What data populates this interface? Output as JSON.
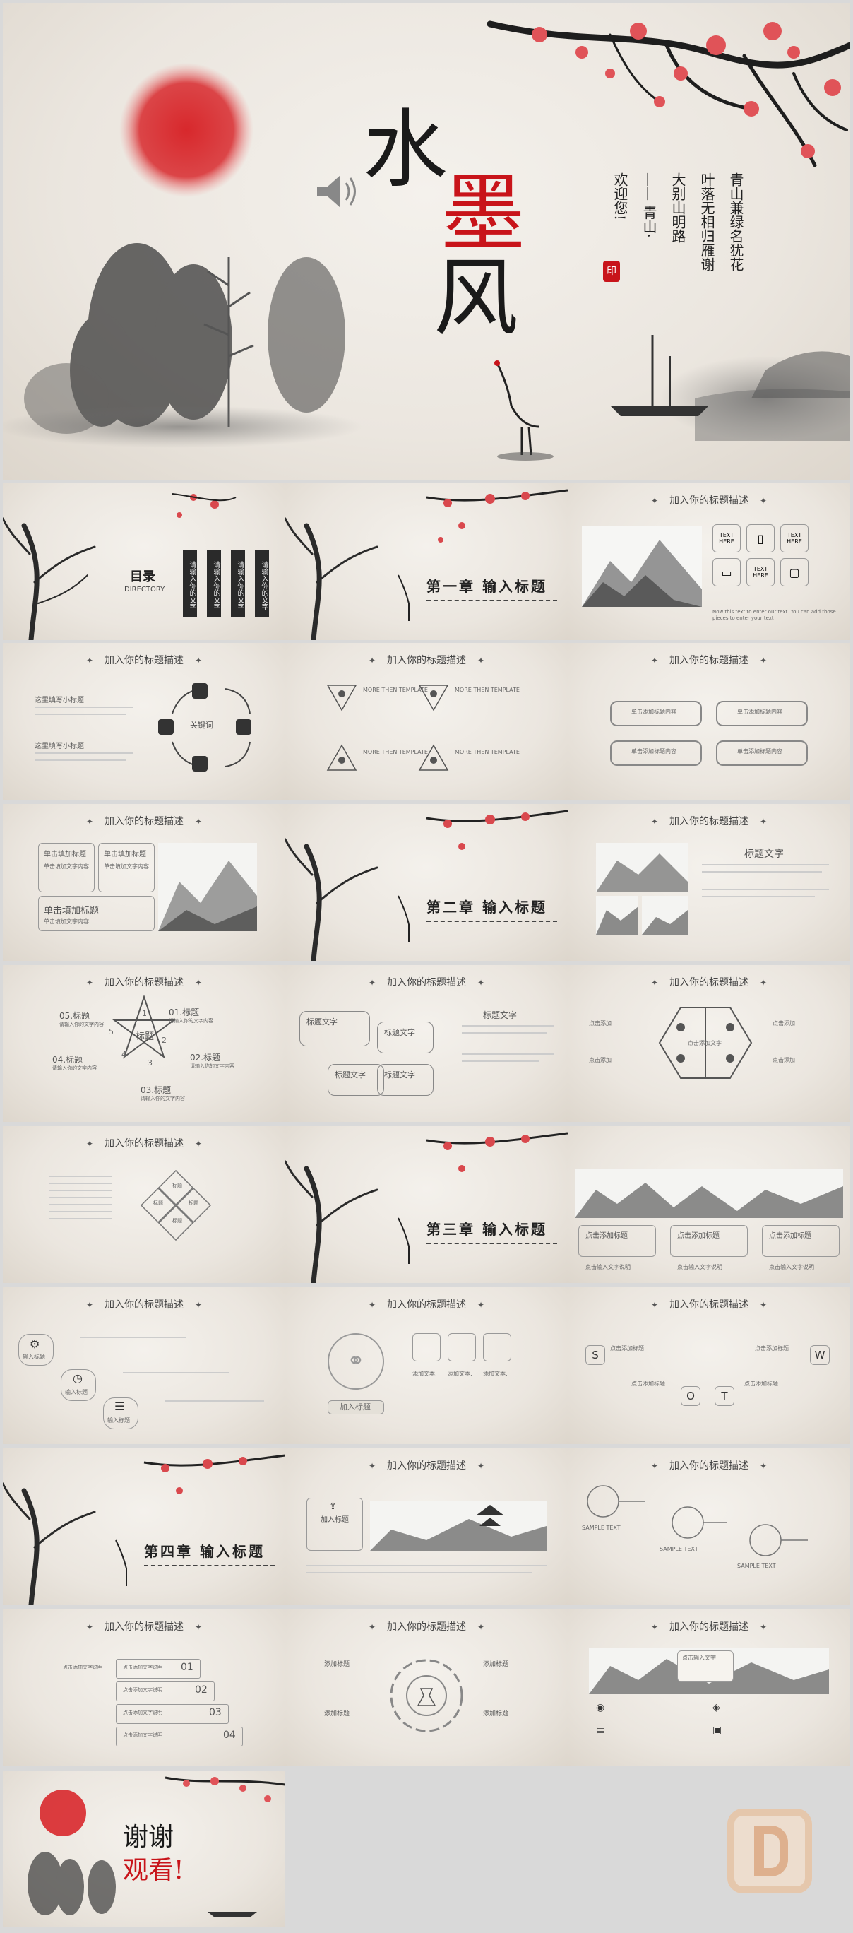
{
  "hero": {
    "title_1": "水",
    "title_2": "墨",
    "title_3": "风",
    "poem_lines": [
      "青山兼绿名犹花",
      "叶落无相归雁谢",
      "大别山明路",
      "—— 青山·",
      "欢迎您!"
    ],
    "seal_text": "印"
  },
  "colors": {
    "red": "#c8141a",
    "ink": "#1a1a1a",
    "paper": "#ece7e0"
  },
  "common": {
    "slide_heading": "加入你的标题描述"
  },
  "toc": {
    "title": "目录",
    "subtitle": "DIRECTORY",
    "items": [
      "请输入你的文字",
      "请输入你的文字",
      "请输入你的文字",
      "请输入你的文字"
    ]
  },
  "chapters": {
    "c1": "第一章 输入标题",
    "c2": "第二章 输入标题",
    "c3": "第三章 输入标题",
    "c4": "第四章 输入标题"
  },
  "s3": {
    "tiles": [
      "TEXT HERE",
      "",
      "TEXT HERE",
      "",
      "TEXT HERE",
      ""
    ],
    "caption": "Now this text to enter our text. You can add those pieces to enter your text"
  },
  "s4": {
    "h1": "这里填写小标题",
    "h2": "这里填写小标题",
    "center": "关键词"
  },
  "s5": {
    "label": "MORE THEN TEMPLATE"
  },
  "s6": {
    "label": "单击添加标题内容"
  },
  "s7": {
    "a": "单击填加标题",
    "b": "单击填加标题",
    "c": "单击填加标题",
    "body": "单击填加文字内容",
    "body_short": "单击填加文字内容"
  },
  "s9": {
    "title": "标题文字"
  },
  "s10": {
    "labels": [
      "05.标题",
      "01.标题",
      "04.标题",
      "02.标题",
      "03.标题"
    ],
    "center": "标题",
    "nums": [
      "1",
      "2",
      "3",
      "4",
      "5"
    ],
    "sub": "请输入你的文字内容"
  },
  "s11": {
    "box": "标题文字",
    "title": "标题文字"
  },
  "s12": {
    "center": "点击添加文字",
    "label": "点击添加"
  },
  "s13": {
    "items": [
      "标题",
      "标题",
      "标题",
      "标题"
    ]
  },
  "s15": {
    "a": "点击添加标题",
    "b": "点击添加标题",
    "c": "点击添加标题",
    "caption": "点击输入文字说明"
  },
  "s16": {
    "labels": [
      "输入标题",
      "输入标题",
      "输入标题"
    ]
  },
  "s17": {
    "btn": "加入标题",
    "col": "添加文本:"
  },
  "s18": {
    "letters": [
      "S",
      "W",
      "O",
      "T"
    ],
    "label": "点击添加标题"
  },
  "s20": {
    "title": "加入标题"
  },
  "s21": {
    "label": "SAMPLE TEXT"
  },
  "s22": {
    "nums": [
      "01",
      "02",
      "03",
      "04"
    ],
    "item": "点击添加文字说明"
  },
  "s23": {
    "label": "添加标题"
  },
  "s24": {
    "callout": "点击输入文字"
  },
  "thanks": {
    "line1": "谢谢",
    "line2": "观看!"
  }
}
